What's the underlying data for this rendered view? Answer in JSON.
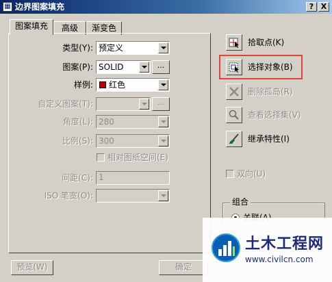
{
  "window": {
    "title": "边界图案填充",
    "help_btn": "?",
    "close_btn": "X"
  },
  "tabs": [
    {
      "label": "图案填充",
      "active": true
    },
    {
      "label": "高级",
      "active": false
    },
    {
      "label": "渐变色",
      "active": false
    }
  ],
  "fields": {
    "type": {
      "label": "类型(Y):",
      "value": "预定义"
    },
    "pattern": {
      "label": "图案(P):",
      "value": "SOLID",
      "browse": "..."
    },
    "swatch": {
      "label": "样例:",
      "value": "红色",
      "color": "#c00000"
    },
    "custom_pattern": {
      "label": "自定义图案(T):",
      "value": "",
      "browse": "..."
    },
    "angle": {
      "label": "角度(L):",
      "value": "280"
    },
    "scale": {
      "label": "比例(S):",
      "value": "300"
    },
    "relative_paper": {
      "label": "相对图纸空间(E)"
    },
    "spacing": {
      "label": "间距(C):",
      "value": "1"
    },
    "iso_pen": {
      "label": "ISO 笔宽(O):",
      "value": ""
    }
  },
  "actions": {
    "pick_points": "拾取点(K)",
    "select_objects": "选择对象(B)",
    "remove_islands": "删除孤岛(R)",
    "view_selections": "查看选择集(V)",
    "inherit_properties": "继承特性(I)"
  },
  "double": {
    "label": "双向(U)"
  },
  "composition": {
    "legend": "组合",
    "associative": "关联(A)"
  },
  "buttons": {
    "preview": "预览(W)",
    "ok": "确定"
  },
  "watermark": {
    "title": "土木工程网",
    "url": "www.civilcn.com"
  },
  "colors": {
    "highlight": "#e04040",
    "titlebar": "#0a246a",
    "watermark_text": "#1d2a7a"
  }
}
